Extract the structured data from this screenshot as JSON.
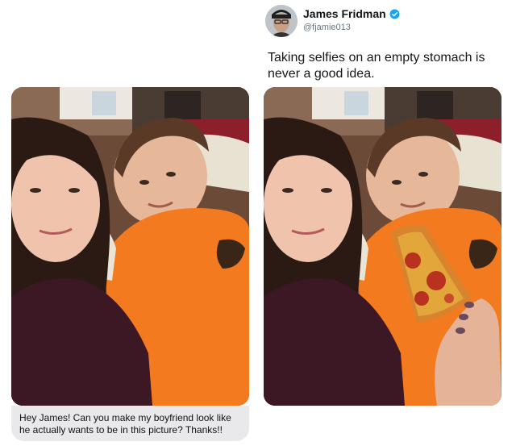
{
  "tweet": {
    "author_name": "James Fridman",
    "author_handle": "@fjamie013",
    "text": "Taking selfies on an empty stomach is never a good idea.",
    "verified": true
  },
  "request": {
    "message": "Hey James! Can you make my boyfriend look like he actually wants to be in this picture? Thanks!!"
  },
  "icons": {
    "avatar": "profile-avatar",
    "verified": "verified-badge-icon"
  },
  "colors": {
    "verified_badge": "#1da1f2",
    "shirt_orange": "#f47a20",
    "bubble_bg": "#e9e9ec"
  }
}
